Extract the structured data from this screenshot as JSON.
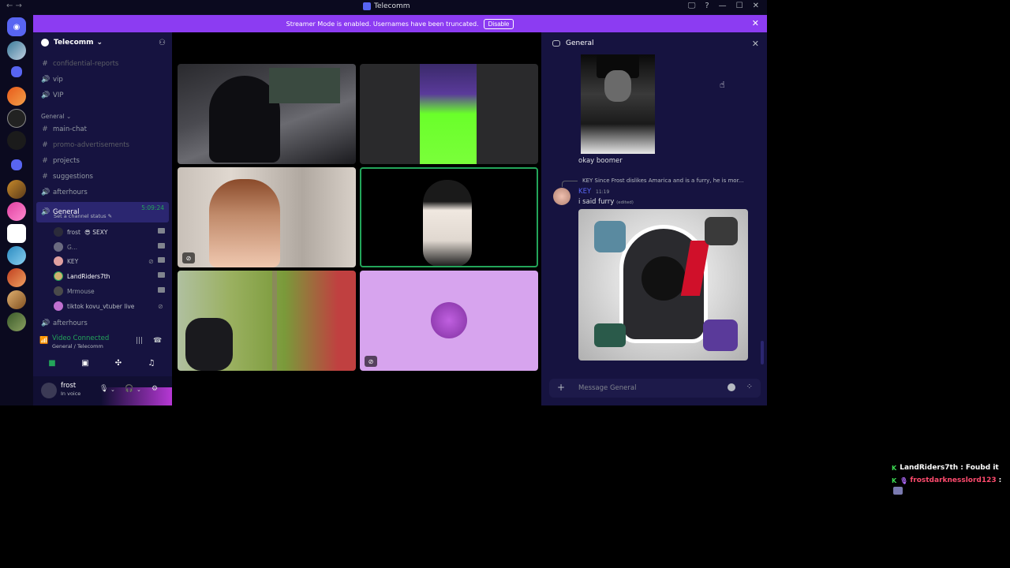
{
  "window": {
    "title": "Telecomm",
    "nav": "← →",
    "controls": [
      "🖵",
      "?",
      "—",
      "☐",
      "✕"
    ]
  },
  "banner": {
    "text": "Streamer Mode is enabled. Usernames have been truncated.",
    "button": "Disable",
    "close": "✕"
  },
  "guild": {
    "name": "Telecomm",
    "chevron": "⌄"
  },
  "channels": {
    "items": [
      {
        "label": "confidential-reports",
        "icon": "#"
      },
      {
        "label": "vip",
        "icon": "🔊"
      },
      {
        "label": "VIP",
        "icon": "🔊"
      },
      {
        "label": "main-chat",
        "icon": "#"
      },
      {
        "label": "promo-advertisements",
        "icon": "#"
      },
      {
        "label": "projects",
        "icon": "#"
      },
      {
        "label": "suggestions",
        "icon": "#"
      },
      {
        "label": "afterhours",
        "icon": "🔊"
      },
      {
        "label": "afterhours",
        "icon": "🔊"
      }
    ],
    "category": "General ⌄",
    "active": {
      "label": "General",
      "timer": "5:09:24",
      "sub": "Set a channel status ✎"
    },
    "voice_users": [
      {
        "name": "frost",
        "extra": "😎 SEXY"
      },
      {
        "name": "G...",
        "extra": ""
      },
      {
        "name": "KEY",
        "extra": ""
      },
      {
        "name": "LandRiders7th",
        "extra": ""
      },
      {
        "name": "Mrmouse",
        "extra": ""
      },
      {
        "name": "tiktok kovu_vtuber live",
        "extra": ""
      }
    ]
  },
  "voice_panel": {
    "title": "Video Connected",
    "sub": "General / Telecomm"
  },
  "user_panel": {
    "name": "frost",
    "status": "In voice"
  },
  "chat": {
    "header": "General",
    "message1": "okay boomer",
    "reply_ref": "KEY Since Frost dislikes Amarica and is a furry, he is mor...",
    "author": "KEY",
    "time": "11:19",
    "message2": "i said furry",
    "edited": "(edited)",
    "placeholder": "Message General"
  },
  "overlay": {
    "line1_name": "LandRiders7th",
    "line1_text": ": Foubd it",
    "line2_name": "frostdarknesslord123",
    "line2_text": ":"
  },
  "colors": {
    "accent": "#5865f2",
    "banner": "#8c3cf2",
    "online": "#23a55a"
  }
}
